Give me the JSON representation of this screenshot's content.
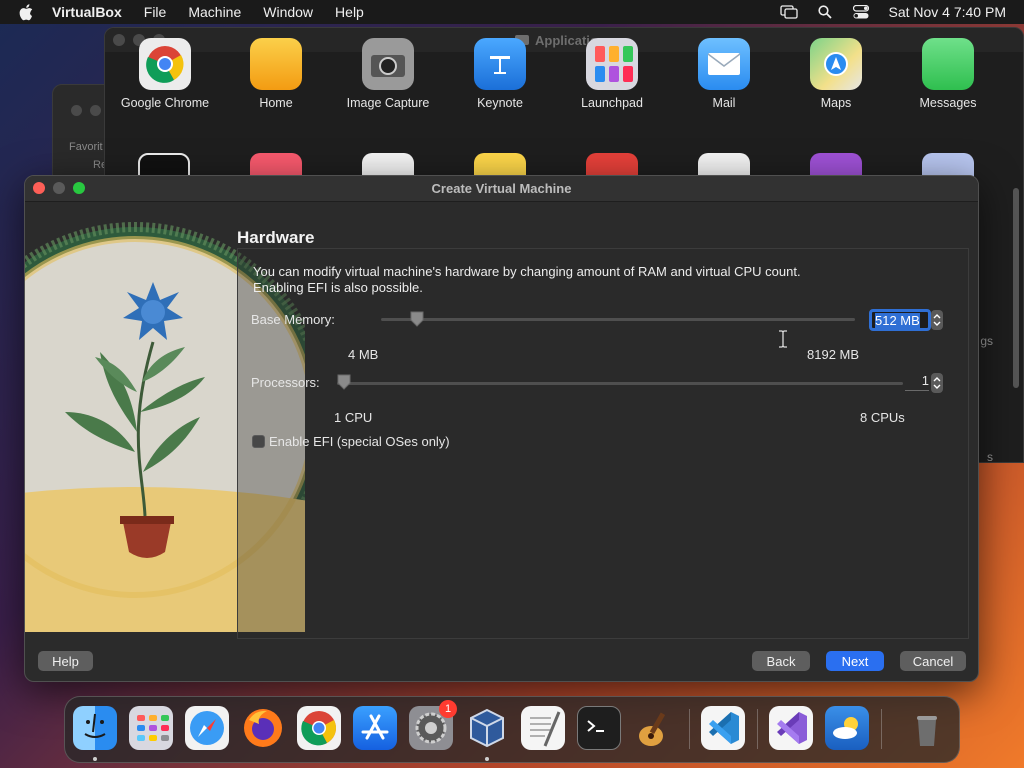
{
  "menubar": {
    "app_name": "VirtualBox",
    "items": [
      "File",
      "Machine",
      "Window",
      "Help"
    ],
    "clock": "Sat Nov 4  7:40 PM"
  },
  "background_windows": {
    "finder_sidebar_label": "Favorit",
    "finder_sidebar_label2": "Re",
    "applications_title": "Applications",
    "right_partial_1": "gs",
    "right_partial_2": "s",
    "apps": [
      {
        "label": "Google Chrome",
        "color": "#e9e9e9"
      },
      {
        "label": "Home",
        "color": "#f6a623"
      },
      {
        "label": "Image Capture",
        "color": "#9a9a9a"
      },
      {
        "label": "Keynote",
        "color": "#2f8cf0"
      },
      {
        "label": "Launchpad",
        "color": "#c8c8d0"
      },
      {
        "label": "Mail",
        "color": "#4aa3f5"
      },
      {
        "label": "Maps",
        "color": "#67c06a"
      },
      {
        "label": "Messages",
        "color": "#34c759"
      }
    ]
  },
  "dialog": {
    "title": "Create Virtual Machine",
    "section_title": "Hardware",
    "description_line1": "You can modify virtual machine's hardware by changing amount of RAM and virtual CPU count.",
    "description_line2": "Enabling EFI is also possible.",
    "base_memory": {
      "label": "Base Memory:",
      "value": "512 MB",
      "min_label": "4 MB",
      "max_label": "8192 MB",
      "fraction": 0.062
    },
    "processors": {
      "label": "Processors:",
      "value": "1",
      "min_label": "1 CPU",
      "max_label": "8 CPUs",
      "fraction": 0.0
    },
    "efi": {
      "label": "Enable EFI (special OSes only)",
      "checked": false
    },
    "buttons": {
      "help": "Help",
      "back": "Back",
      "next": "Next",
      "cancel": "Cancel"
    }
  },
  "dock": {
    "apps": [
      {
        "name": "Finder",
        "color": "#2a8cf0"
      },
      {
        "name": "Launchpad",
        "color": "#d8d8e0"
      },
      {
        "name": "Safari",
        "color": "#3a9cf5"
      },
      {
        "name": "Firefox",
        "color": "#ff7a1a"
      },
      {
        "name": "Google Chrome",
        "color": "#f2f2f2"
      },
      {
        "name": "App Store",
        "color": "#1c7cf2"
      },
      {
        "name": "System Settings",
        "color": "#8e8e93"
      },
      {
        "name": "VirtualBox",
        "color": "#2f5a9c"
      },
      {
        "name": "TextEdit",
        "color": "#f5f5f5"
      },
      {
        "name": "Terminal",
        "color": "#1e1e1e"
      },
      {
        "name": "GarageBand",
        "color": "#e0a040"
      },
      {
        "name": "Visual Studio Code",
        "color": "#2a8ad4"
      },
      {
        "name": "Visual Studio",
        "color": "#8a5cd8"
      },
      {
        "name": "Weather",
        "color": "#3a8fe8"
      },
      {
        "name": "Trash",
        "color": "#8a8a8a"
      }
    ],
    "settings_badge": "1"
  }
}
